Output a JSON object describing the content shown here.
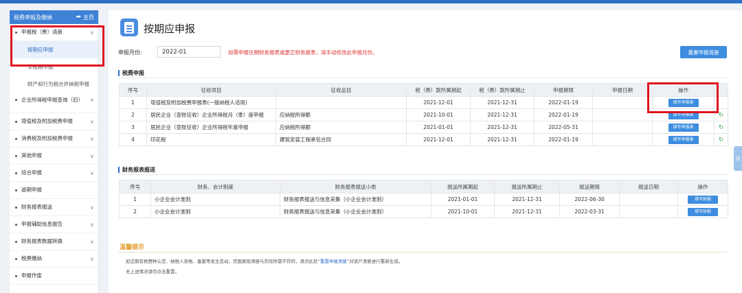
{
  "sidebar": {
    "header_title": "税费申报及缴纳",
    "home_label": "主页",
    "items": [
      {
        "label": "申报税（费）清册",
        "chevron": "∨"
      },
      {
        "label": "企业所得税申报查询（旧）",
        "chevron": "∨"
      },
      {
        "label": "增值税及附加税费申报",
        "chevron": "∨"
      },
      {
        "label": "消费税及附加税费申报",
        "chevron": "∨"
      },
      {
        "label": "其他申报",
        "chevron": "∨"
      },
      {
        "label": "综合申报",
        "chevron": "∨"
      },
      {
        "label": "逾期申报",
        "chevron": ""
      },
      {
        "label": "财务报表报送",
        "chevron": "∨"
      },
      {
        "label": "申报辅助信息报告",
        "chevron": "∨"
      },
      {
        "label": "财务报表数据转换",
        "chevron": "∨"
      },
      {
        "label": "税费缴纳",
        "chevron": "∨"
      },
      {
        "label": "申报作废",
        "chevron": ""
      }
    ],
    "subitems": [
      {
        "label": "按期应申报"
      },
      {
        "label": "非按期申报"
      },
      {
        "label": "财产和行为税合并纳税申报"
      }
    ]
  },
  "page": {
    "title": "按期应申报",
    "month_label": "申报月份:",
    "month_value": "2022-01",
    "hint": "如需申报往期财务报表或更正财务报表，请手动修改此申报月份。",
    "reset_button": "重置申报清册"
  },
  "tax_section": {
    "title": "税费申报",
    "headers": [
      "序号",
      "征收项目",
      "征收品目",
      "税（费）款所属期起",
      "税（费）款所属期止",
      "申报期限",
      "申报日期",
      "操作"
    ],
    "rows": [
      {
        "no": "1",
        "item": "增值税及附加税费申报表(一般纳税人适用)",
        "sub": "",
        "start": "2021-12-01",
        "end": "2021-12-31",
        "deadline": "2022-01-19",
        "date": "",
        "action": "填写申报表"
      },
      {
        "no": "2",
        "item": "居民企业（查账征收）企业所得税月（季）度申报",
        "sub": "应纳税所得额",
        "start": "2021-10-01",
        "end": "2021-12-31",
        "deadline": "2022-01-19",
        "date": "",
        "action": "填写申报表"
      },
      {
        "no": "3",
        "item": "居民企业（查账征收）企业所得税年度申报",
        "sub": "应纳税所得额",
        "start": "2021-01-01",
        "end": "2021-12-31",
        "deadline": "2022-05-31",
        "date": "",
        "action": "填写申报表"
      },
      {
        "no": "4",
        "item": "印花税",
        "sub": "建筑安装工程承包合同",
        "start": "2021-12-01",
        "end": "2021-12-31",
        "deadline": "2022-01-19",
        "date": "",
        "action": "填写申报表"
      }
    ]
  },
  "report_section": {
    "title": "财务报表报送",
    "headers": [
      "序号",
      "财务、会计制度",
      "财务报表报送小类",
      "报送所属期起",
      "报送所属期止",
      "报送期限",
      "报送日期",
      "操作"
    ],
    "rows": [
      {
        "no": "1",
        "system": "小企业会计准则",
        "sub": "财务报表报送与信息采集（小企业会计准则）",
        "start": "2021-01-01",
        "end": "2021-12-31",
        "deadline": "2022-06-30",
        "date": "",
        "action": "填写财报"
      },
      {
        "no": "2",
        "system": "小企业会计准则",
        "sub": "财务报表报送与信息采集（小企业会计准则）",
        "start": "2021-10-01",
        "end": "2021-12-31",
        "deadline": "2022-03-31",
        "date": "",
        "action": "填写财报"
      }
    ]
  },
  "notice": {
    "title": "温馨提示",
    "line1_pre": "如近期有税费种认定、纳税人资格、备案等发生变动，页面展现清册与实际所需不符的，请点此处“",
    "line1_link": "重置申报清册",
    "line1_post": "”对该户清册进行重新生成。",
    "line2": "无上述情况请勿点击重置。"
  },
  "side_tab": "设",
  "colors": {
    "accent": "#3e8de0",
    "alert": "#e0121f",
    "notice": "#e39a2c"
  }
}
